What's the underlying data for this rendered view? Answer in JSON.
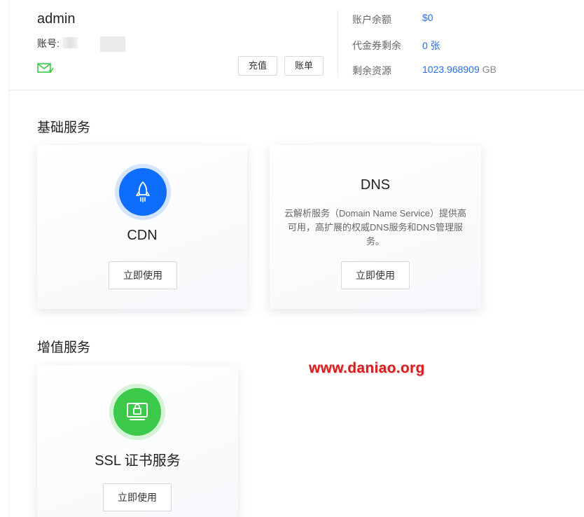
{
  "header": {
    "username": "admin",
    "account_label": "账号:",
    "recharge_label": "充值",
    "bill_label": "账单",
    "stats": [
      {
        "label": "账户余额",
        "value": "$0",
        "unit": ""
      },
      {
        "label": "代金券剩余",
        "value": "0 张",
        "unit": ""
      },
      {
        "label": "剩余资源",
        "value": "1023.968909",
        "unit": "GB"
      }
    ]
  },
  "sections": {
    "basic_title": "基础服务",
    "value_added_title": "增值服务"
  },
  "cards": {
    "cdn": {
      "title": "CDN",
      "button": "立即使用",
      "icon": "rocket-icon"
    },
    "dns": {
      "title": "DNS",
      "description": "云解析服务（Domain Name Service）提供高可用，高扩展的权威DNS服务和DNS管理服务。",
      "button": "立即使用"
    },
    "ssl": {
      "title": "SSL 证书服务",
      "button": "立即使用",
      "icon": "ssl-lock-icon"
    }
  },
  "watermark": "www.daniao.org",
  "colors": {
    "accent_blue": "#2a6ee6",
    "cdn_icon_bg": "#0d6efd",
    "ssl_icon_bg": "#3cc94a",
    "mail_icon": "#3cc94a",
    "watermark": "#d81e1e"
  }
}
